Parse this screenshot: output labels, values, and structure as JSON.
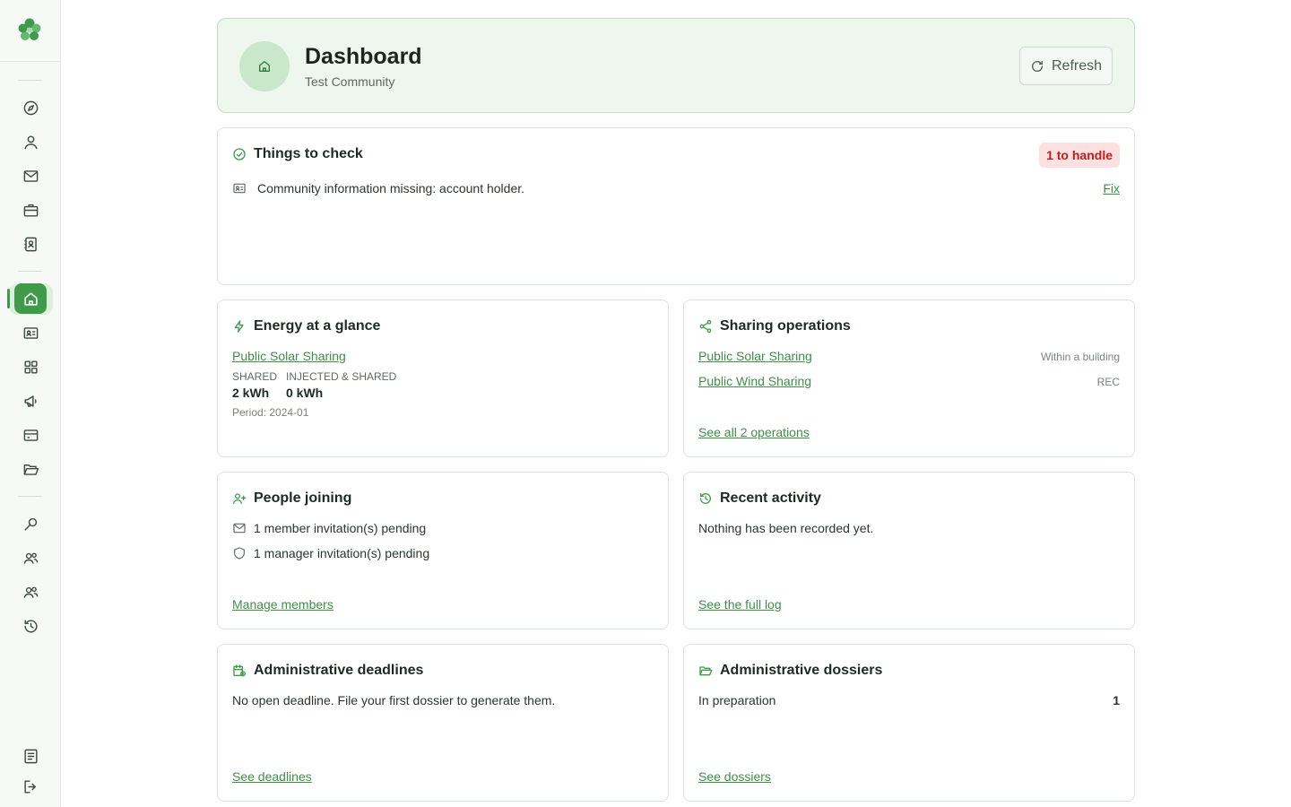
{
  "header": {
    "title": "Dashboard",
    "subtitle": "Test Community",
    "refresh_label": "Refresh"
  },
  "check": {
    "title": "Things to check",
    "badge": "1 to handle",
    "item_text": "Community information missing: account holder.",
    "fix_label": "Fix"
  },
  "energy": {
    "title": "Energy at a glance",
    "operation_link": "Public Solar Sharing",
    "shared_label": "SHARED",
    "shared_value": "2 kWh",
    "injected_label": "INJECTED & SHARED",
    "injected_value": "0 kWh",
    "period": "Period: 2024-01"
  },
  "sharing": {
    "title": "Sharing operations",
    "operations": [
      {
        "name": "Public Solar Sharing",
        "type": "Within a building"
      },
      {
        "name": "Public Wind Sharing",
        "type": "REC"
      }
    ],
    "see_all": "See all 2 operations"
  },
  "people": {
    "title": "People joining",
    "member_invites": "1 member invitation(s) pending",
    "manager_invites": "1 manager invitation(s) pending",
    "manage_link": "Manage members"
  },
  "activity": {
    "title": "Recent activity",
    "empty": "Nothing has been recorded yet.",
    "log_link": "See the full log"
  },
  "deadlines": {
    "title": "Administrative deadlines",
    "empty": "No open deadline. File your first dossier to generate them.",
    "link": "See deadlines"
  },
  "dossiers": {
    "title": "Administrative dossiers",
    "status_label": "In preparation",
    "status_count": "1",
    "link": "See dossiers"
  },
  "colors": {
    "accent": "#3f9b4a",
    "accent_light": "#eef7ee",
    "danger_bg": "#fde0e0",
    "danger_text": "#c31b1b"
  }
}
